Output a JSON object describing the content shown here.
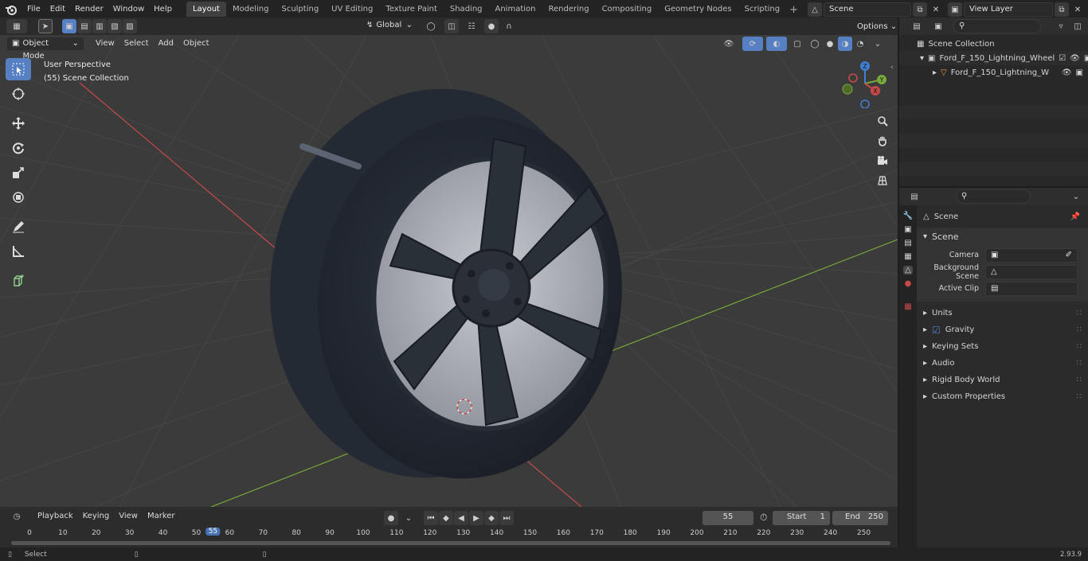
{
  "menu": {
    "file": "File",
    "edit": "Edit",
    "render": "Render",
    "window": "Window",
    "help": "Help"
  },
  "workspaces": [
    "Layout",
    "Modeling",
    "Sculpting",
    "UV Editing",
    "Texture Paint",
    "Shading",
    "Animation",
    "Rendering",
    "Compositing",
    "Geometry Nodes",
    "Scripting"
  ],
  "active_workspace": "Layout",
  "scene_field": "Scene",
  "view_layer_field": "View Layer",
  "viewport": {
    "mode": "Object Mode",
    "menus": [
      "View",
      "Select",
      "Add",
      "Object"
    ],
    "transform_orientation": "Global",
    "options": "Options",
    "overlay_title": "User Perspective",
    "overlay_subtitle": "(55) Scene Collection",
    "gizmo": {
      "x": "X",
      "y": "Y",
      "z": "Z"
    }
  },
  "outliner": {
    "collection": "Scene Collection",
    "items": [
      "Ford_F_150_Lightning_Wheel",
      "Ford_F_150_Lightning_W"
    ]
  },
  "properties": {
    "context": "Scene",
    "panel": "Scene",
    "fields": [
      {
        "label": "Camera"
      },
      {
        "label": "Background Scene"
      },
      {
        "label": "Active Clip"
      }
    ],
    "subpanels": [
      "Units",
      "Gravity",
      "Keying Sets",
      "Audio",
      "Rigid Body World",
      "Custom Properties"
    ],
    "gravity_checked": true
  },
  "timeline": {
    "menus": [
      "Playback",
      "Keying",
      "View",
      "Marker"
    ],
    "current_frame": "55",
    "start_label": "Start",
    "start": "1",
    "end_label": "End",
    "end": "250",
    "ticks": [
      "0",
      "10",
      "20",
      "30",
      "40",
      "50",
      "55",
      "60",
      "70",
      "80",
      "90",
      "100",
      "110",
      "120",
      "130",
      "140",
      "150",
      "160",
      "170",
      "180",
      "190",
      "200",
      "210",
      "220",
      "230",
      "240",
      "250"
    ]
  },
  "status": {
    "left": "Select",
    "version": "2.93.9"
  },
  "colors": {
    "accent": "#5680c2",
    "x_axis": "#c74a4a",
    "y_axis": "#7aa83a",
    "z_axis": "#3f7fd4"
  }
}
